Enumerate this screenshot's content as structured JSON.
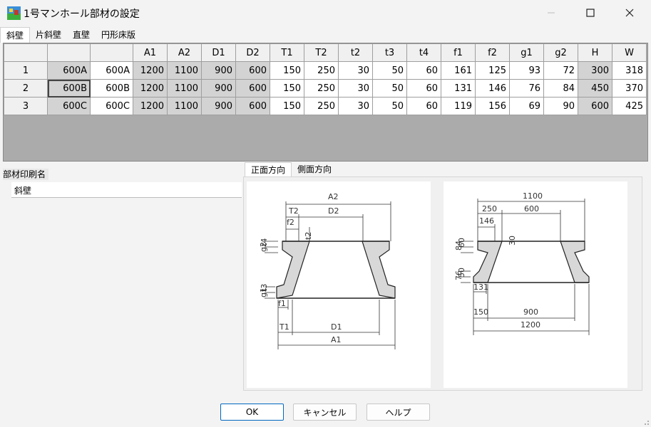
{
  "window": {
    "title": "1号マンホール部材の設定"
  },
  "tabs": [
    "斜壁",
    "片斜壁",
    "直壁",
    "円形床版"
  ],
  "grid": {
    "columns": [
      "",
      "",
      "A1",
      "A2",
      "D1",
      "D2",
      "T1",
      "T2",
      "t2",
      "t3",
      "t4",
      "f1",
      "f2",
      "g1",
      "g2",
      "H",
      "W"
    ],
    "rows": [
      {
        "no": "1",
        "code": "600A",
        "name": "600A",
        "vals": [
          "1200",
          "1100",
          "900",
          "600",
          "150",
          "250",
          "30",
          "50",
          "60",
          "161",
          "125",
          "93",
          "72",
          "300",
          "318"
        ]
      },
      {
        "no": "2",
        "code": "600B",
        "name": "600B",
        "vals": [
          "1200",
          "1100",
          "900",
          "600",
          "150",
          "250",
          "30",
          "50",
          "60",
          "131",
          "146",
          "76",
          "84",
          "450",
          "370"
        ]
      },
      {
        "no": "3",
        "code": "600C",
        "name": "600C",
        "vals": [
          "1200",
          "1100",
          "900",
          "600",
          "150",
          "250",
          "30",
          "50",
          "60",
          "119",
          "156",
          "69",
          "90",
          "600",
          "425"
        ]
      }
    ]
  },
  "print_name": {
    "label": "部材印刷名",
    "value": "斜壁"
  },
  "direction_tabs": [
    "正面方向",
    "側面方向"
  ],
  "front_diagram": {
    "labels": {
      "A2": "A2",
      "T2": "T2",
      "D2": "D2",
      "f2": "f2",
      "t2": "t2",
      "g2": "g2",
      "t4": "t4",
      "g1": "g1",
      "t3": "t3",
      "f1": "f1",
      "T1": "T1",
      "D1": "D1",
      "A1": "A1"
    }
  },
  "side_diagram": {
    "labels": {
      "top_outer": "1100",
      "top_wall": "250",
      "top_inner": "600",
      "top_f": "146",
      "top_t": "30",
      "g_upper": "84",
      "t_upper": "60",
      "g_lower": "76",
      "t_lower": "50",
      "bottom_f": "131",
      "bottom_wall": "150",
      "bottom_inner": "900",
      "bottom_outer": "1200"
    }
  },
  "buttons": {
    "ok": "OK",
    "cancel": "キャンセル",
    "help": "ヘルプ"
  }
}
